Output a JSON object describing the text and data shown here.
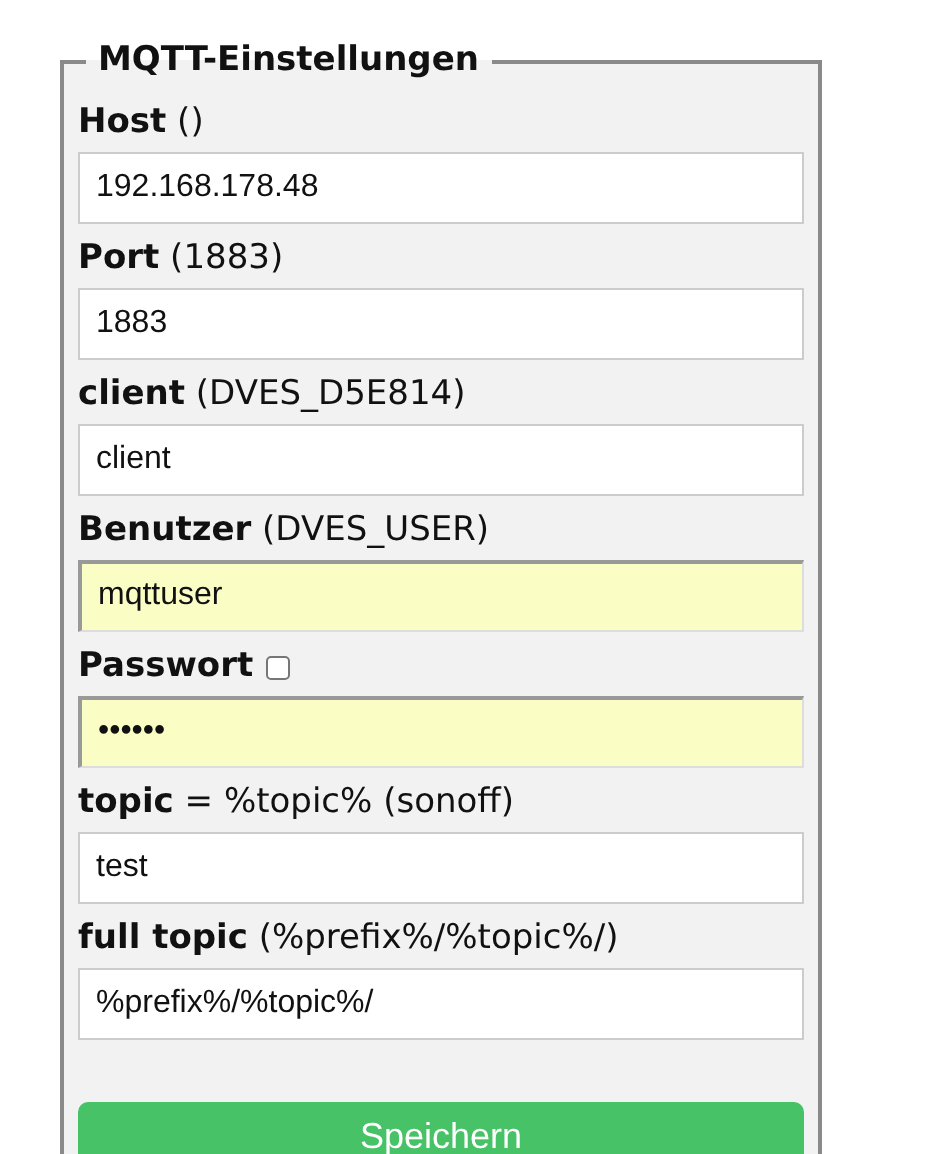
{
  "fieldset": {
    "legend": "MQTT-Einstellungen"
  },
  "fields": [
    {
      "kind": "plain",
      "label": "Host",
      "note": " ()",
      "value": "192.168.178.48",
      "autofilled": false
    },
    {
      "kind": "plain",
      "label": "Port",
      "note": " (1883)",
      "value": "1883",
      "autofilled": false
    },
    {
      "kind": "plain",
      "label": "client",
      "note": " (DVES_D5E814)",
      "value": "client",
      "autofilled": false
    },
    {
      "kind": "plain",
      "label": "Benutzer",
      "note": " (DVES_USER)",
      "value": "mqttuser",
      "autofilled": true
    },
    {
      "kind": "password",
      "label": "Passwort",
      "show_checkbox": {
        "checked": false
      },
      "value": "••••••",
      "autofilled": true
    },
    {
      "kind": "plain",
      "label": "topic",
      "note": " = %topic% (sonoff)",
      "value": "test",
      "autofilled": false
    },
    {
      "kind": "plain",
      "label": "full topic",
      "note": " (%prefix%/%topic%/)",
      "value": "%prefix%/%topic%/",
      "autofilled": false
    }
  ],
  "save_button": "Speichern"
}
